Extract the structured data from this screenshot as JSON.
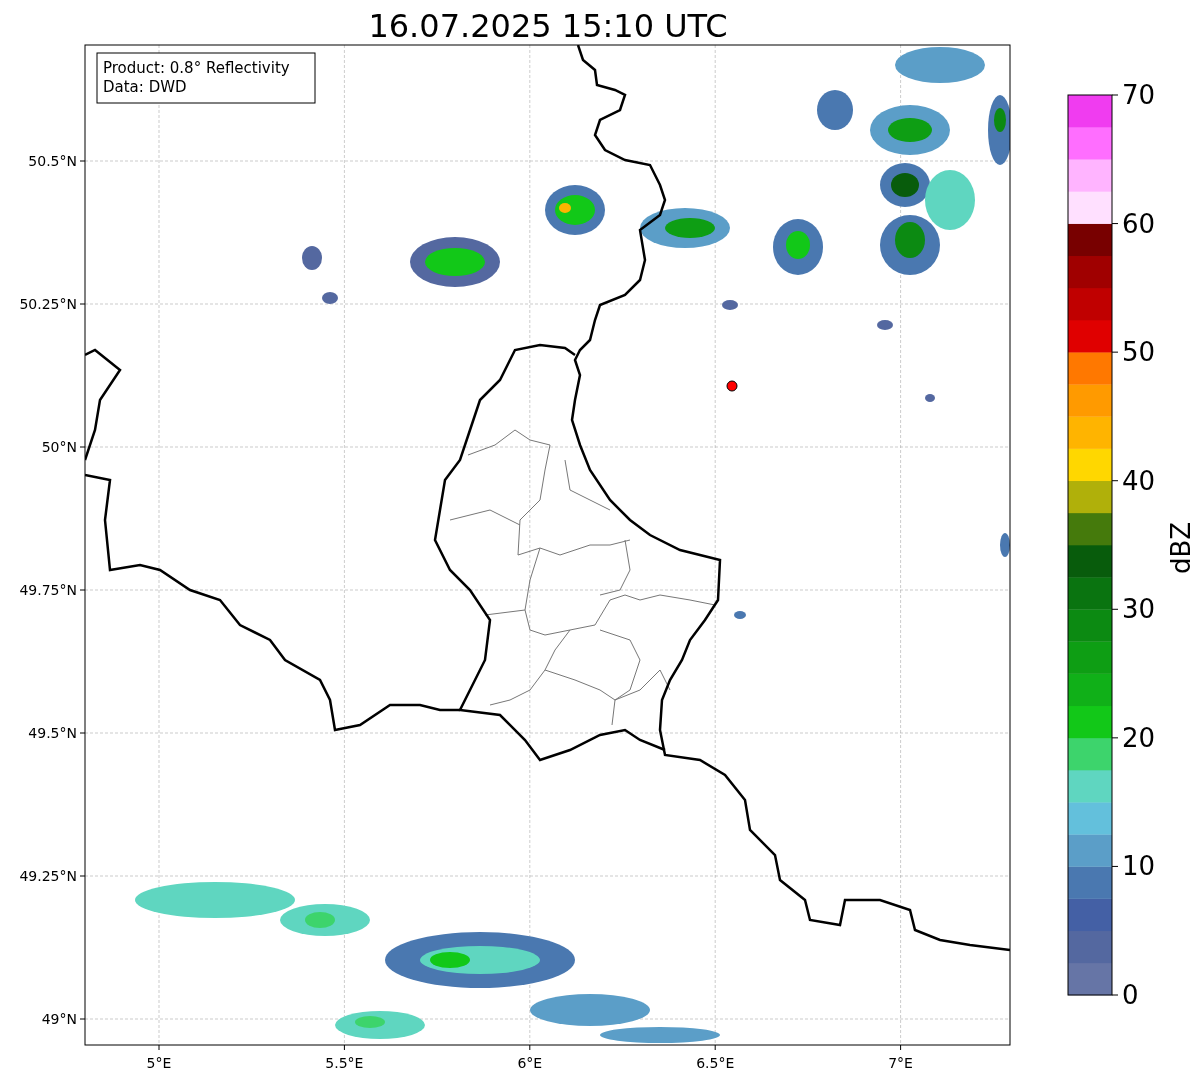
{
  "title": "16.07.2025 15:10 UTC",
  "info_box": [
    "Product: 0.8° Reflectivity",
    "Data: DWD"
  ],
  "x_ticks": [
    "5°E",
    "5.5°E",
    "6°E",
    "6.5°E",
    "7°E"
  ],
  "y_ticks": [
    "50.5°N",
    "50.25°N",
    "50°N",
    "49.75°N",
    "49.5°N",
    "49.25°N",
    "49°N"
  ],
  "colorbar": {
    "label": "dBZ",
    "ticks": [
      "70",
      "60",
      "50",
      "40",
      "30",
      "20",
      "10",
      "0"
    ],
    "bins": [
      {
        "color": "#6675a6"
      },
      {
        "color": "#5468a0"
      },
      {
        "color": "#4460a5"
      },
      {
        "color": "#4a78b0"
      },
      {
        "color": "#5b9ec8"
      },
      {
        "color": "#63c0dc"
      },
      {
        "color": "#5fd6c0"
      },
      {
        "color": "#3dd46c"
      },
      {
        "color": "#12c818"
      },
      {
        "color": "#10b018"
      },
      {
        "color": "#0e9e14"
      },
      {
        "color": "#0c8a12"
      },
      {
        "color": "#0a7410"
      },
      {
        "color": "#085c0c"
      },
      {
        "color": "#457a0c"
      },
      {
        "color": "#b0b00a"
      },
      {
        "color": "#ffd700"
      },
      {
        "color": "#ffb400"
      },
      {
        "color": "#ff9a00"
      },
      {
        "color": "#ff7800"
      },
      {
        "color": "#e00000"
      },
      {
        "color": "#c00000"
      },
      {
        "color": "#a00000"
      },
      {
        "color": "#780000"
      },
      {
        "color": "#ffe0ff"
      },
      {
        "color": "#ffb4ff"
      },
      {
        "color": "#ff6eff"
      },
      {
        "color": "#f03cf0"
      }
    ]
  }
}
